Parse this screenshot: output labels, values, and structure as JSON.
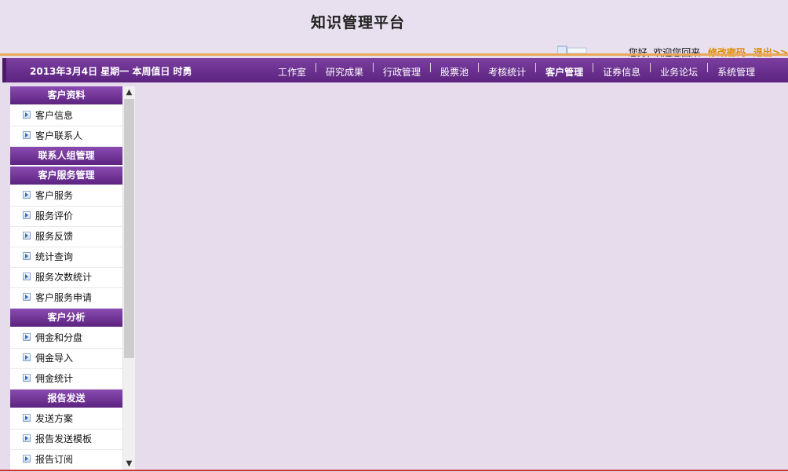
{
  "header": {
    "title": "知识管理平台",
    "welcome": "您好, 欢迎您回来",
    "change_password": "修改密码",
    "logout": "退出>>"
  },
  "nav": {
    "date": "2013年3月4日  星期一  本周值日  时勇",
    "items": [
      {
        "label": "工作室"
      },
      {
        "label": "研究成果"
      },
      {
        "label": "行政管理"
      },
      {
        "label": "股票池"
      },
      {
        "label": "考核统计"
      },
      {
        "label": "客户管理",
        "active": true
      },
      {
        "label": "证券信息"
      },
      {
        "label": "业务论坛"
      },
      {
        "label": "系统管理"
      }
    ]
  },
  "sidebar": {
    "groups": [
      {
        "header": "客户资料",
        "items": [
          "客户信息",
          "客户联系人"
        ]
      },
      {
        "header": "联系人组管理",
        "items": []
      },
      {
        "header": "客户服务管理",
        "items": [
          "客户服务",
          "服务评价",
          "服务反馈",
          "统计查询",
          "服务次数统计",
          "客户服务申请"
        ]
      },
      {
        "header": "客户分析",
        "items": [
          "佣金和分盘",
          "佣金导入",
          "佣金统计"
        ]
      },
      {
        "header": "报告发送",
        "items": [
          "发送方案",
          "报告发送模板",
          "报告订阅"
        ]
      }
    ]
  },
  "colors": {
    "nav_purple": "#5c237f",
    "accent_orange": "#e08a00",
    "background": "#e6dcec"
  }
}
